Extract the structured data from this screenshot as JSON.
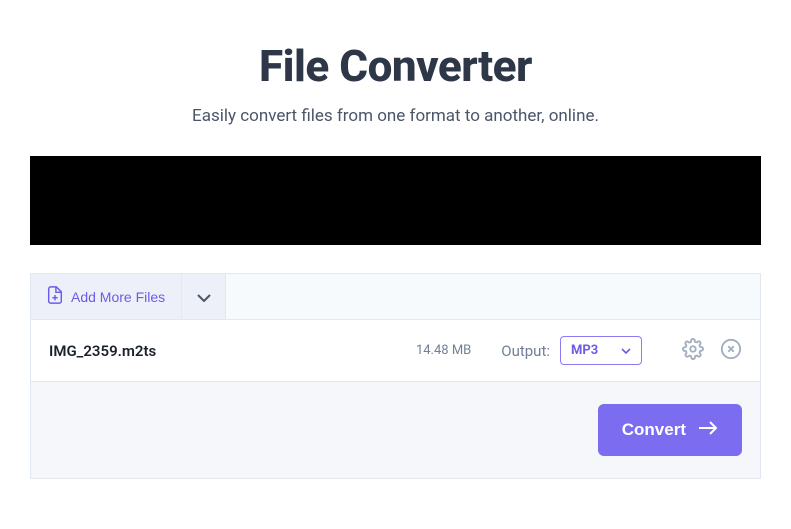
{
  "header": {
    "title": "File Converter",
    "subtitle": "Easily convert files from one format to another, online."
  },
  "toolbar": {
    "add_more_label": "Add More Files"
  },
  "files": [
    {
      "name": "IMG_2359.m2ts",
      "size": "14.48 MB",
      "output_label": "Output:",
      "output_format": "MP3"
    }
  ],
  "actions": {
    "convert_label": "Convert"
  }
}
